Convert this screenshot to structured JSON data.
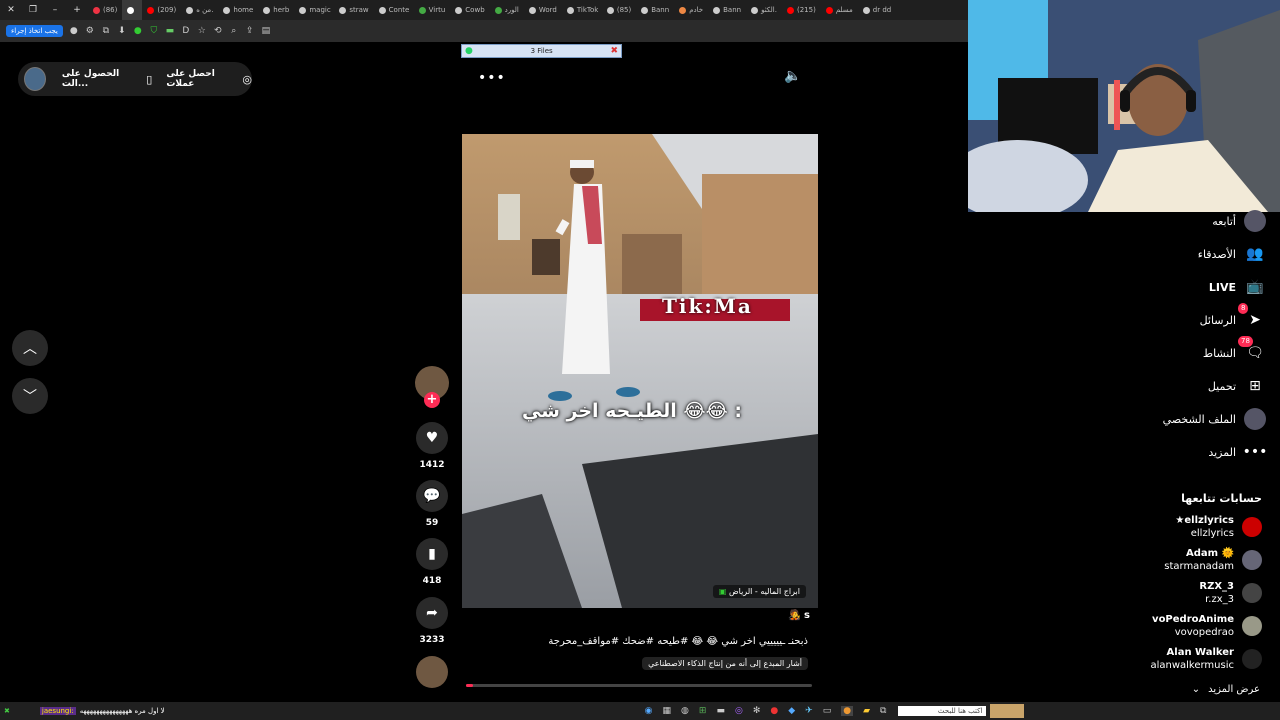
{
  "browser": {
    "tabs": [
      {
        "label": "(86)",
        "color": "#e34"
      },
      {
        "label": "",
        "color": "#fff",
        "active": true
      },
      {
        "label": "(209)",
        "color": "#f00"
      },
      {
        "label": "من ه.",
        "color": "#ccc"
      },
      {
        "label": "home",
        "color": "#ccc"
      },
      {
        "label": "herb",
        "color": "#ccc"
      },
      {
        "label": "magic",
        "color": "#ccc"
      },
      {
        "label": "straw",
        "color": "#ccc"
      },
      {
        "label": "Conte",
        "color": "#ccc"
      },
      {
        "label": "Virtu",
        "color": "#4a4"
      },
      {
        "label": "Cowb",
        "color": "#ccc"
      },
      {
        "label": "الورد",
        "color": "#4a4"
      },
      {
        "label": "Word",
        "color": "#ccc"
      },
      {
        "label": "TikTok",
        "color": "#ccc"
      },
      {
        "label": "(85)",
        "color": "#ccc"
      },
      {
        "label": "Bann",
        "color": "#ccc"
      },
      {
        "label": "خادم",
        "color": "#e84"
      },
      {
        "label": "Bann",
        "color": "#ccc"
      },
      {
        "label": "الكثو.",
        "color": "#ccc"
      },
      {
        "label": "(215)",
        "color": "#f00"
      },
      {
        "label": "مسلم",
        "color": "#f00"
      },
      {
        "label": "dr dd",
        "color": "#ccc"
      }
    ],
    "toolbar_pill": "يجب اتخاذ إجراء"
  },
  "topbar": {
    "get_coins": "احصل على عملات",
    "get_app": "الحصول على الت..."
  },
  "files_bar": {
    "label": "3 Files"
  },
  "video": {
    "overlay_brand": "Tik:Ma",
    "caption_overlay": "الطيـحه اخر شي 😂😂 :",
    "location": "ابراج الماليه - الرياض",
    "author_initial": "s",
    "description": "ذبحنـ ـيييييي اخر شي 😂 😂 #طيحه #ضحك #مواقف_محرجة",
    "ai_notice": "أشار المبدع إلى أنه من إنتاج الذكاء الاصطناعي"
  },
  "actions": {
    "likes": "1412",
    "comments": "59",
    "saves": "418",
    "shares": "3233"
  },
  "sidebar": {
    "items": [
      {
        "label": "أتابعه",
        "icon": "following-avatar-icon"
      },
      {
        "label": "الأصدقاء",
        "icon": "friends-icon"
      },
      {
        "label": "LIVE",
        "icon": "live-tv-icon"
      },
      {
        "label": "الرسائل",
        "icon": "messages-icon",
        "badge": "8"
      },
      {
        "label": "النشاط",
        "icon": "activity-icon",
        "badge": "78"
      },
      {
        "label": "تحميل",
        "icon": "upload-icon"
      },
      {
        "label": "الملف الشخصي",
        "icon": "profile-avatar-icon"
      },
      {
        "label": "المزيد",
        "icon": "more-dots-icon"
      }
    ],
    "following_title": "حسابات تتابعها",
    "accounts": [
      {
        "name": "★ellzlyrics",
        "handle": "ellzlyrics",
        "color": "#c00"
      },
      {
        "name": "Adam 🌞",
        "handle": "starmanadam",
        "color": "#667"
      },
      {
        "name": "RZX_3",
        "handle": "r.zx_3",
        "color": "#444"
      },
      {
        "name": "voPedroAnime",
        "handle": "vovopedrao",
        "color": "#998"
      },
      {
        "name": "Alan Walker",
        "handle": "alanwalkermusic",
        "color": "#222"
      }
    ],
    "see_more": "عرض المزيد"
  },
  "taskbar": {
    "chat_user": "jaesungi:",
    "chat_text": "لا اول مره هههههههههههههههه",
    "search": "اكتب هنا للبحث"
  }
}
